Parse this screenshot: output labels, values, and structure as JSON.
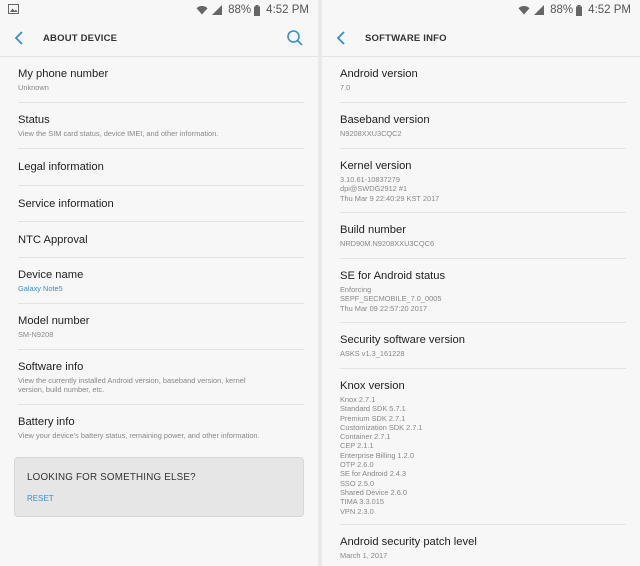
{
  "status_bar": {
    "battery": "88%",
    "time": "4:52 PM"
  },
  "left": {
    "title": "ABOUT DEVICE",
    "items": [
      {
        "title": "My phone number",
        "sub": "Unknown"
      },
      {
        "title": "Status",
        "sub": "View the SIM card status, device IMEI, and other information."
      },
      {
        "title": "Legal information"
      },
      {
        "title": "Service information"
      },
      {
        "title": "NTC Approval"
      },
      {
        "title": "Device name",
        "sub": "Galaxy Note5"
      },
      {
        "title": "Model number",
        "sub": "SM-N9208"
      },
      {
        "title": "Software info",
        "sub": "View the currently installed Android version, baseband version, kernel\nversion, build number, etc."
      },
      {
        "title": "Battery info",
        "sub": "View your device's battery status, remaining power, and other information."
      }
    ],
    "looking": {
      "title": "LOOKING FOR SOMETHING ELSE?",
      "action": "RESET"
    }
  },
  "right": {
    "title": "SOFTWARE INFO",
    "items": [
      {
        "title": "Android version",
        "lines": [
          "7.0"
        ]
      },
      {
        "title": "Baseband version",
        "lines": [
          "N9208XXU3CQC2"
        ]
      },
      {
        "title": "Kernel version",
        "lines": [
          "3.10.61-10837279",
          "dpi@SWDG2912 #1",
          "Thu Mar 9 22:40:29 KST 2017"
        ]
      },
      {
        "title": "Build number",
        "lines": [
          "NRD90M.N9208XXU3CQC6"
        ]
      },
      {
        "title": "SE for Android status",
        "lines": [
          "Enforcing",
          "SEPF_SECMOBILE_7.0_0005",
          "Thu Mar 09 22:57:20 2017"
        ]
      },
      {
        "title": "Security software version",
        "lines": [
          "ASKS v1.3_161228"
        ]
      },
      {
        "title": "Knox version",
        "lines": [
          "Knox 2.7.1",
          "Standard SDK 5.7.1",
          "Premium SDK 2.7.1",
          "Customization SDK 2.7.1",
          "Container 2.7.1",
          "CEP 2.1.1",
          "Enterprise Billing 1.2.0",
          "OTP 2.6.0",
          "SE for Android 2.4.3",
          "SSO 2.5.0",
          "Shared Device 2.6.0",
          "TIMA 3.3.015",
          "VPN 2.3.0"
        ]
      },
      {
        "title": "Android security patch level",
        "lines": [
          "March 1, 2017"
        ]
      }
    ]
  }
}
